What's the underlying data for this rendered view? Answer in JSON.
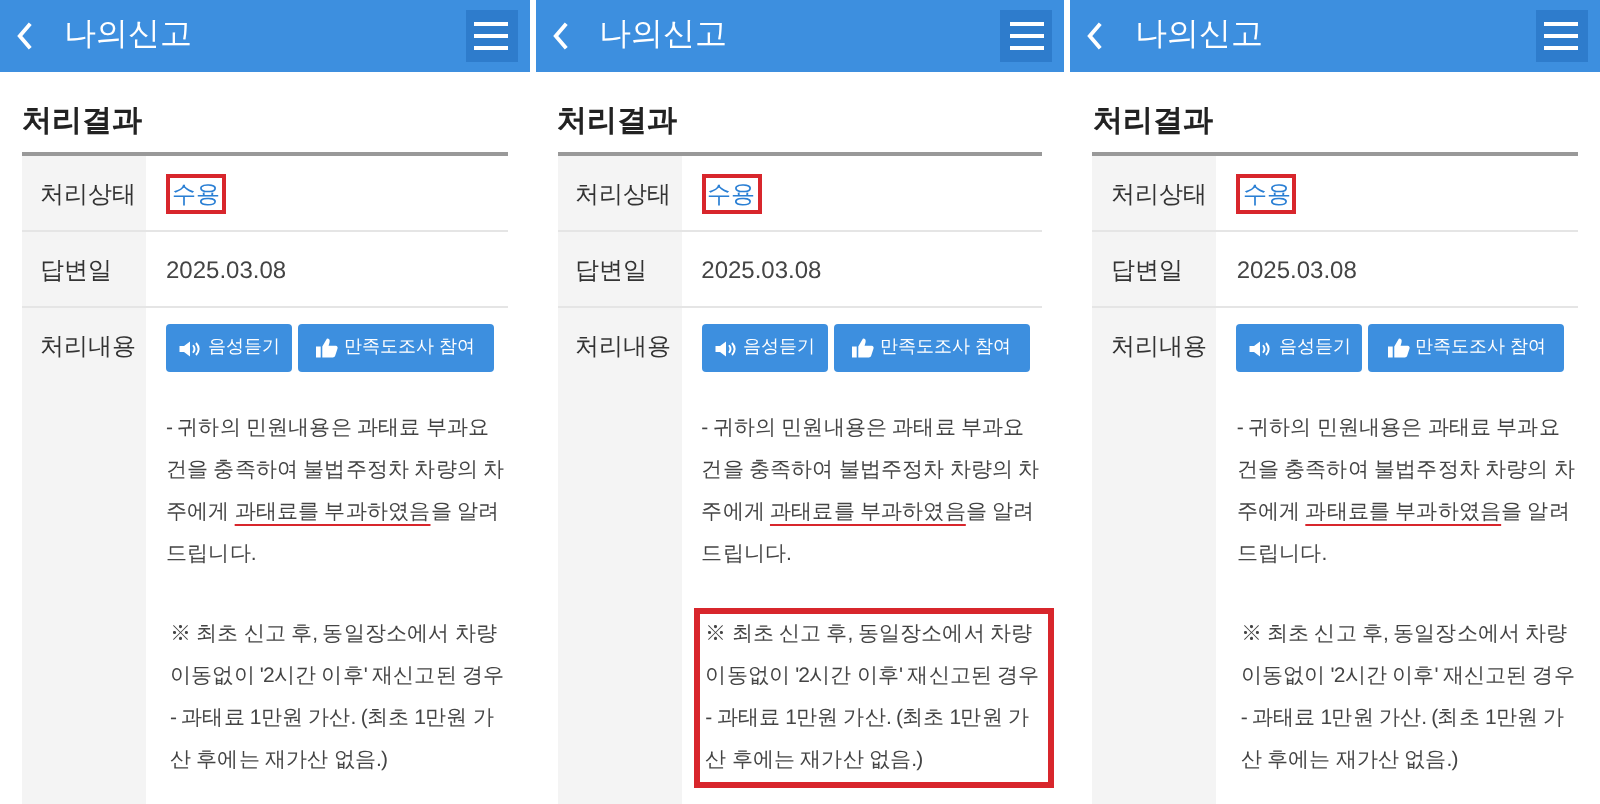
{
  "panels": [
    {
      "header": {
        "title": "나의신고"
      },
      "section_title": "처리결과",
      "rows": [
        {
          "kind": "status",
          "label": "처리상태",
          "value": "수용",
          "highlighted": true
        },
        {
          "kind": "text",
          "label": "답변일",
          "value": "2025.03.08"
        },
        {
          "kind": "content",
          "label": "처리내용",
          "buttons": [
            {
              "kind": "audio",
              "label": "음성듣기"
            },
            {
              "kind": "survey",
              "label": "만족도조사 참여"
            }
          ],
          "paragraph": [
            {
              "text": "- 귀하의 민원내용은 과태료 부과요건을 충족하여 불법주정차 차량의 차주에게 ",
              "underlined": false
            },
            {
              "text": "과태료를 부과하였음",
              "underlined": true
            },
            {
              "text": "을 알려드립니다.",
              "underlined": false
            }
          ],
          "note": {
            "text": "※ 최초 신고 후, 동일장소에서 차량 이동없이 '2시간 이후' 재신고된 경우 - 과태료 1만원 가산. (최초 1만원 가산 후에는 재가산 없음.)",
            "highlighted": false
          }
        }
      ]
    },
    {
      "header": {
        "title": "나의신고"
      },
      "section_title": "처리결과",
      "rows": [
        {
          "kind": "status",
          "label": "처리상태",
          "value": "수용",
          "highlighted": true
        },
        {
          "kind": "text",
          "label": "답변일",
          "value": "2025.03.08"
        },
        {
          "kind": "content",
          "label": "처리내용",
          "buttons": [
            {
              "kind": "audio",
              "label": "음성듣기"
            },
            {
              "kind": "survey",
              "label": "만족도조사 참여"
            }
          ],
          "paragraph": [
            {
              "text": "- 귀하의 민원내용은 과태료 부과요건을 충족하여 불법주정차 차량의 차주에게 ",
              "underlined": false
            },
            {
              "text": "과태료를 부과하였음",
              "underlined": true
            },
            {
              "text": "을 알려드립니다.",
              "underlined": false
            }
          ],
          "note": {
            "text": "※ 최초 신고 후, 동일장소에서 차량 이동없이 '2시간 이후' 재신고된 경우 - 과태료 1만원 가산. (최초 1만원 가산 후에는 재가산 없음.)",
            "highlighted": true
          }
        }
      ]
    },
    {
      "header": {
        "title": "나의신고"
      },
      "section_title": "처리결과",
      "rows": [
        {
          "kind": "status",
          "label": "처리상태",
          "value": "수용",
          "highlighted": true
        },
        {
          "kind": "text",
          "label": "답변일",
          "value": "2025.03.08"
        },
        {
          "kind": "content",
          "label": "처리내용",
          "buttons": [
            {
              "kind": "audio",
              "label": "음성듣기"
            },
            {
              "kind": "survey",
              "label": "만족도조사 참여"
            }
          ],
          "paragraph": [
            {
              "text": "- 귀하의 민원내용은 과태료 부과요건을 충족하여 불법주정차 차량의 차주에게 ",
              "underlined": false
            },
            {
              "text": "과태료를 부과하였음",
              "underlined": true
            },
            {
              "text": "을 알려드립니다.",
              "underlined": false
            }
          ],
          "note": {
            "text": "※ 최초 신고 후, 동일장소에서 차량 이동없이 '2시간 이후' 재신고된 경우 - 과태료 1만원 가산. (최초 1만원 가산 후에는 재가산 없음.)",
            "highlighted": false
          }
        }
      ]
    }
  ]
}
